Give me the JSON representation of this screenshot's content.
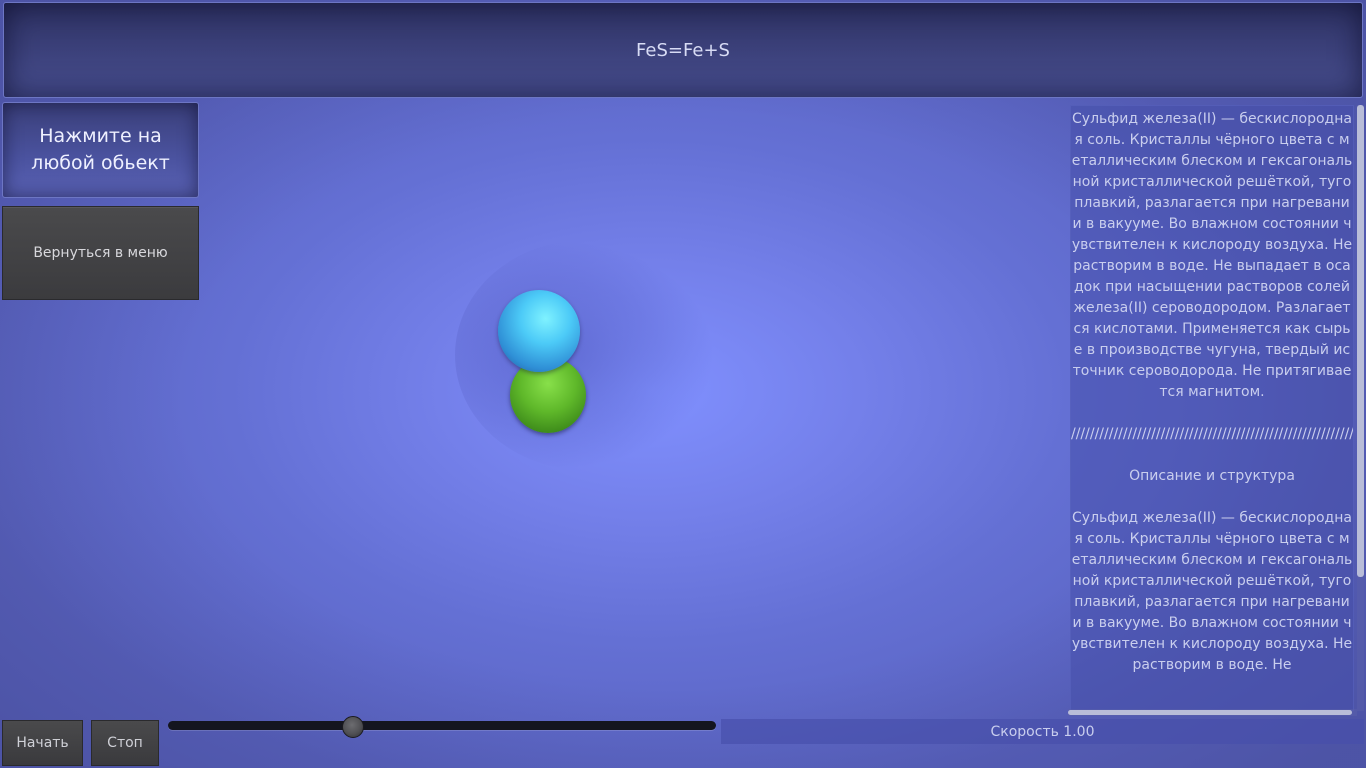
{
  "header": {
    "title": "FeS=Fe+S"
  },
  "sidebar": {
    "hint": "Нажмите на любой обьект",
    "menu_button": "Вернуться в меню"
  },
  "scene": {
    "atoms": [
      {
        "name": "blue-atom",
        "color": "#4ccaf7"
      },
      {
        "name": "green-atom",
        "color": "#5fb82a"
      }
    ],
    "background_color": "#7480ea"
  },
  "info": {
    "text": "Сульфид железа(II) — бескислородная соль. Кристаллы чёрного цвета с металлическим блеском и гексагональной кристаллической решёткой, тугоплавкий, разлагается при нагревании в вакууме. Во влажном состоянии чувствителен к кислороду воздуха. Нерастворим в воде. Не выпадает в осадок при насыщении растворов солей железа(II) сероводородом. Разлагается кислотами. Применяется как сырье в производстве чугуна, твердый источник сероводорода. Не притягивается магнитом.\n\n///////////////////////////////////////////////////////////////////\n\nОписание и структура\n\nСульфид железа(II) — бескислородная соль. Кристаллы чёрного цвета с металлическим блеском и гексагональной кристаллической решёткой, тугоплавкий, разлагается при нагревании в вакууме. Во влажном состоянии чувствителен к кислороду воздуха. Нерастворим в воде. Не"
  },
  "controls": {
    "start_label": "Начать",
    "stop_label": "Стоп",
    "slider_fraction": 0.338,
    "speed_label": "Скорость 1.00"
  }
}
